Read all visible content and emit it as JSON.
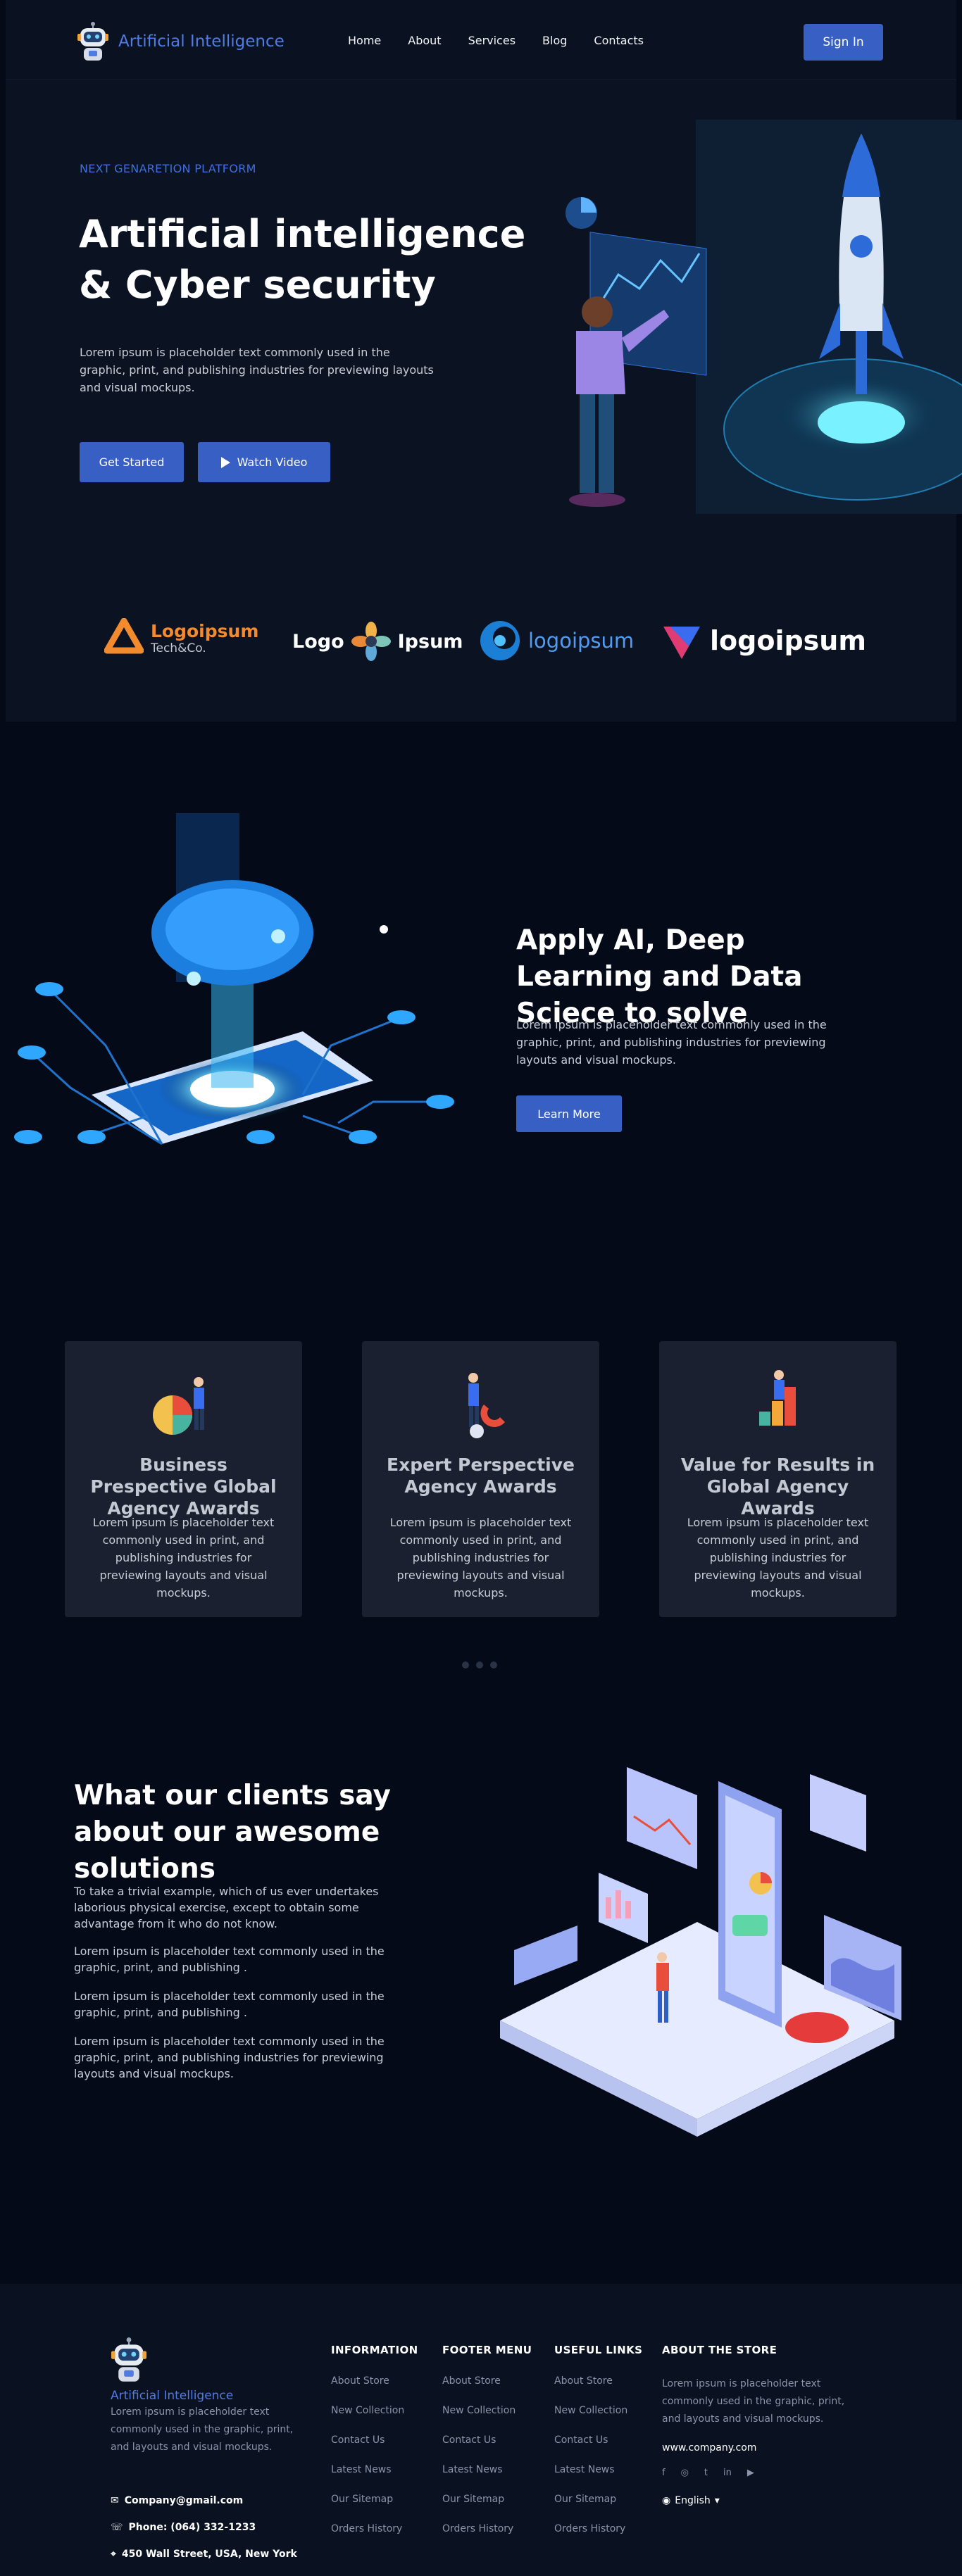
{
  "nav": {
    "brand": "Artificial Intelligence",
    "links": [
      "Home",
      "About",
      "Services",
      "Blog",
      "Contacts"
    ],
    "sign_in": "Sign In"
  },
  "hero": {
    "eyebrow": "NEXT GENARETION PLATFORM",
    "title_line1": "Artificial intelligence",
    "title_line2": "& Cyber security",
    "description": "Lorem ipsum is placeholder text commonly used in the graphic, print, and publishing industries for previewing layouts and visual mockups.",
    "btn_started": "Get Started",
    "btn_video": "Watch Video"
  },
  "logos": [
    {
      "name": "Logoipsum",
      "sub": "Tech&Co.",
      "icon": "triangle-logo-icon"
    },
    {
      "name_left": "Logo",
      "name_right": "Ipsum",
      "icon": "flower-logo-icon"
    },
    {
      "name": "logoipsum",
      "icon": "swirl-logo-icon"
    },
    {
      "name": "logoipsum",
      "icon": "bird-logo-icon"
    }
  ],
  "ai": {
    "title": "Apply AI, Deep Learning and Data Sciece to solve",
    "description": "Lorem ipsum is placeholder text commonly used in the graphic, print, and publishing industries for previewing layouts and visual mockups.",
    "button": "Learn More"
  },
  "cards": [
    {
      "title": "Business Prespective Global Agency Awards",
      "desc": "Lorem ipsum is placeholder text commonly used in print, and publishing industries for previewing layouts and visual mockups."
    },
    {
      "title": "Expert Perspective Agency Awards",
      "desc": "Lorem ipsum is placeholder text commonly used in print, and publishing industries for previewing layouts and visual mockups."
    },
    {
      "title": "Value for Results in Global Agency Awards",
      "desc": "Lorem ipsum is placeholder text commonly used in print, and publishing industries for previewing layouts and visual mockups."
    }
  ],
  "clients": {
    "title": "What our clients say about our awesome solutions",
    "p1": "To take a trivial example, which of us ever undertakes laborious physical exercise, except to obtain some advantage from it who do not know.",
    "p2": "Lorem ipsum is placeholder text commonly used in the graphic, print, and publishing .",
    "p3": "Lorem ipsum is placeholder text commonly used in the graphic, print, and publishing .",
    "p4": "Lorem ipsum is placeholder text commonly used in the graphic, print, and publishing industries for previewing layouts and visual mockups."
  },
  "footer": {
    "brand": "Artificial Intelligence",
    "about": "Lorem ipsum is placeholder text commonly used in the graphic, print, and layouts and visual mockups.",
    "email": "Company@gmail.com",
    "phone": "Phone: (064) 332-1233",
    "address": "450 Wall Street, USA, New York",
    "columns": [
      {
        "title": "INFORMATION",
        "links": [
          "About Store",
          "New Collection",
          "Contact Us",
          "Latest News",
          "Our Sitemap",
          "Orders History"
        ]
      },
      {
        "title": "FOOTER MENU",
        "links": [
          "About Store",
          "New Collection",
          "Contact Us",
          "Latest News",
          "Our Sitemap",
          "Orders History"
        ]
      },
      {
        "title": "USEFUL LINKS",
        "links": [
          "About Store",
          "New Collection",
          "Contact Us",
          "Latest News",
          "Our Sitemap",
          "Orders History"
        ]
      }
    ],
    "store": {
      "title": "ABOUT THE STORE",
      "desc": "Lorem ipsum is placeholder text commonly used in the graphic, print, and layouts and visual mockups.",
      "website": "www.company.com",
      "social": [
        "f",
        "◎",
        "t",
        "in",
        "▶"
      ],
      "language": "English"
    }
  },
  "colors": {
    "accent": "#3860c4",
    "brand": "#4f7be3",
    "background": "#040a17",
    "card": "#1a2030"
  }
}
